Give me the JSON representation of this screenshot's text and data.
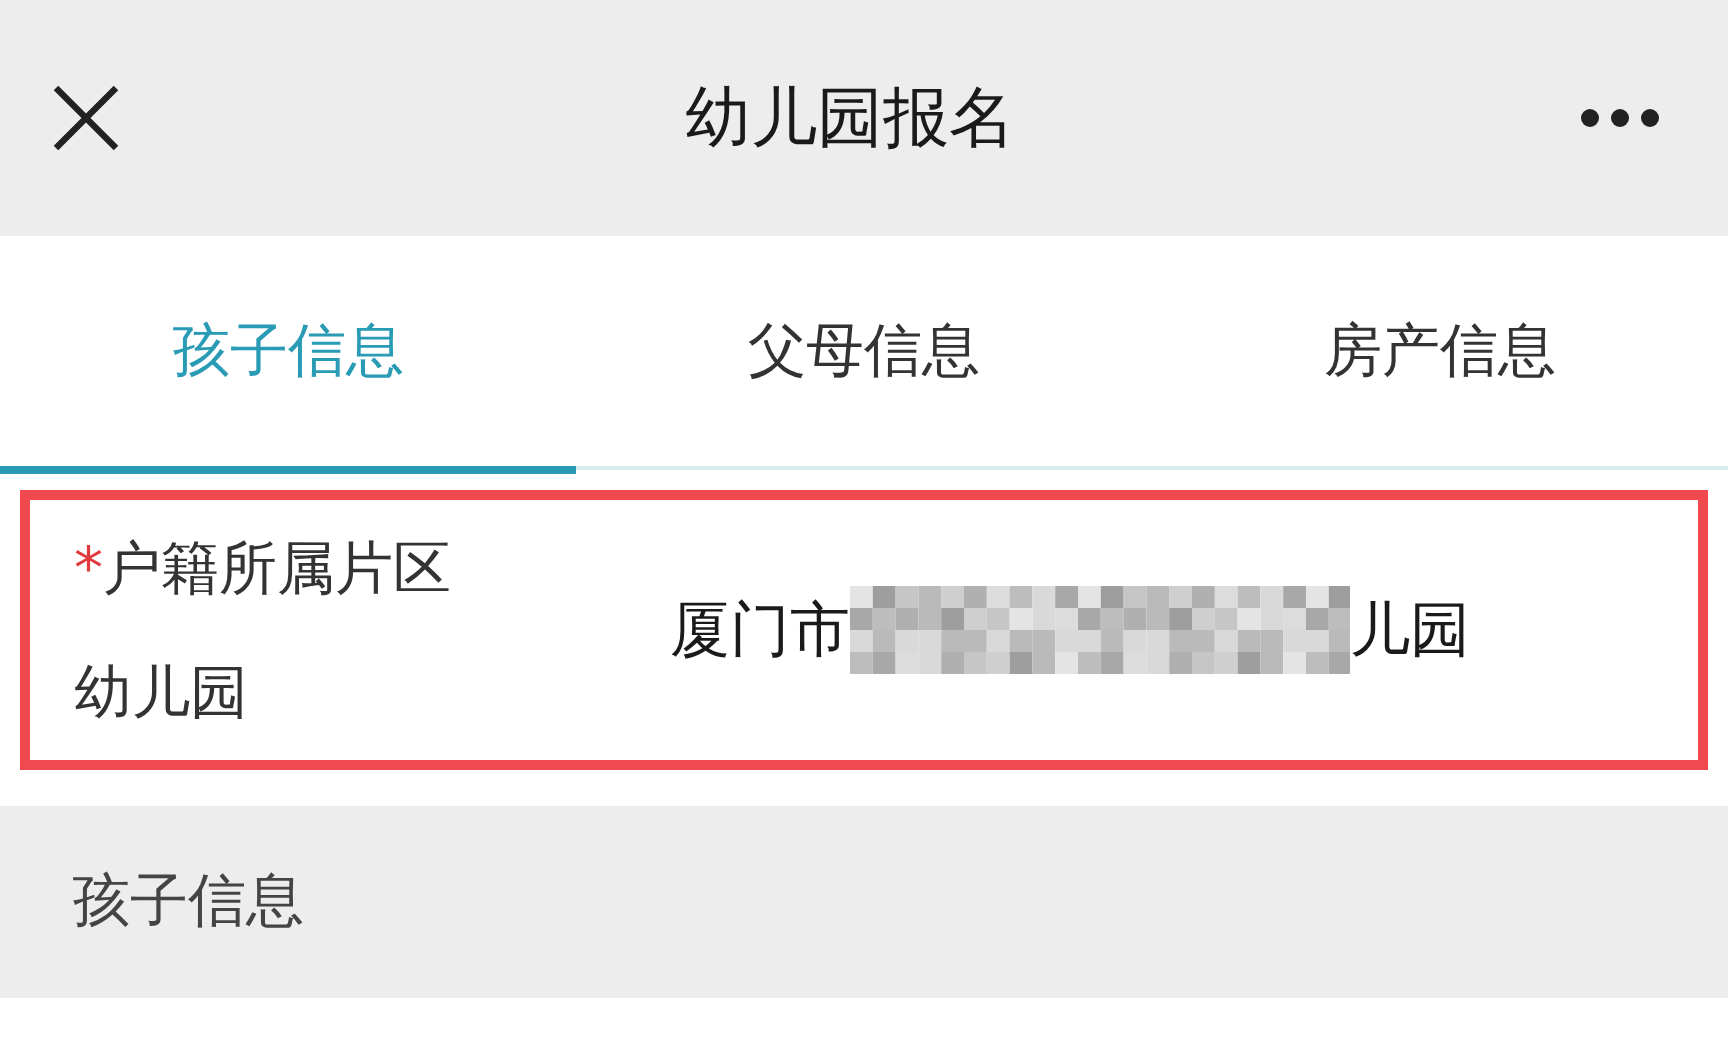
{
  "header": {
    "title": "幼儿园报名"
  },
  "tabs": [
    {
      "label": "孩子信息",
      "selected": true
    },
    {
      "label": "父母信息",
      "selected": false
    },
    {
      "label": "房产信息",
      "selected": false
    }
  ],
  "field": {
    "required_mark": "*",
    "label": "户籍所属片区幼儿园",
    "value_start": "厦门市",
    "redacted": true,
    "value_end": "儿园",
    "highlighted": true
  },
  "section": {
    "title": "孩子信息"
  }
}
